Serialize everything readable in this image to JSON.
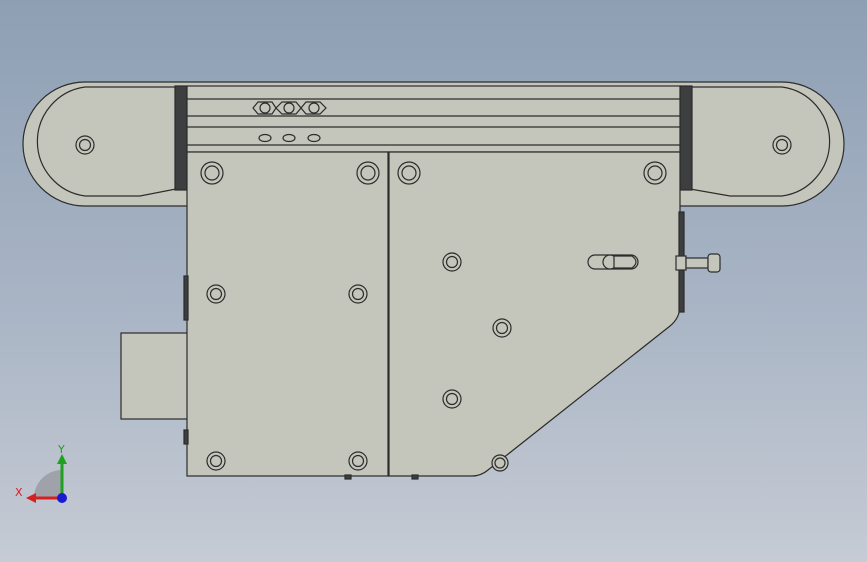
{
  "colors": {
    "background_top": "#8e9fb4",
    "background_bottom": "#c6cbd4",
    "part_fill": "#c5c6bb",
    "edge": "#2c2c2c",
    "dark_frame": "#3c3e3f",
    "x_axis": "#d42020",
    "y_axis": "#1fa01f",
    "z_axis": "#1a1ad4"
  },
  "triad": {
    "x_label": "X",
    "y_label": "Y"
  }
}
